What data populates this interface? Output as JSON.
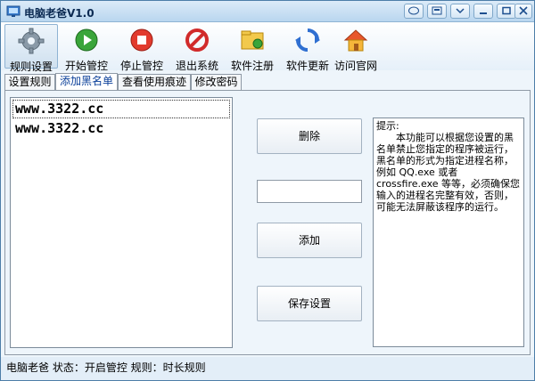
{
  "window": {
    "title": "电脑老爸V1.0"
  },
  "toolbar": {
    "items": [
      {
        "label": "规则设置",
        "icon": "gear-icon"
      },
      {
        "label": "开始管控",
        "icon": "play-icon"
      },
      {
        "label": "停止管控",
        "icon": "stop-icon"
      },
      {
        "label": "退出系统",
        "icon": "exit-icon"
      },
      {
        "label": "软件注册",
        "icon": "register-icon"
      },
      {
        "label": "软件更新",
        "icon": "refresh-icon"
      },
      {
        "label": "访问官网",
        "icon": "home-icon"
      }
    ]
  },
  "tabs": [
    {
      "label": "设置规则"
    },
    {
      "label": "添加黑名单"
    },
    {
      "label": "查看使用痕迹"
    },
    {
      "label": "修改密码"
    }
  ],
  "blacklist": {
    "items": [
      "www.3322.cc",
      "www.3322.cc"
    ]
  },
  "buttons": {
    "delete": "删除",
    "add": "添加",
    "save": "保存设置"
  },
  "add_input": {
    "value": ""
  },
  "tip": {
    "title": "提示:",
    "body": "本功能可以根据您设置的黑名单禁止您指定的程序被运行，黑名单的形式为指定进程名称，例如 QQ.exe 或者 crossfire.exe 等等，必须确保您输入的进程名完整有效，否则，可能无法屏蔽该程序的运行。"
  },
  "status": {
    "text": "电脑老爸 状态：开启管控 规则：时长规则"
  }
}
